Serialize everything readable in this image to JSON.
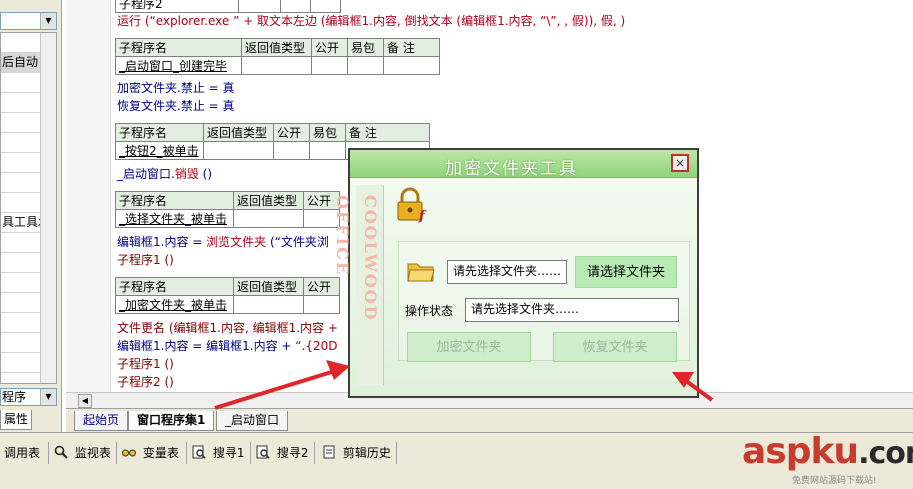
{
  "left_panel": {
    "rows": [
      "",
      "后自动",
      "",
      "",
      "",
      "",
      "",
      "",
      "",
      "具工具木",
      "",
      "",
      "",
      "",
      "",
      "",
      ""
    ],
    "selected_row": 1,
    "combo_value": "程序",
    "tab_label": "属性"
  },
  "editor": {
    "top_table_partial": "子程序2",
    "line_run": [
      "运行 (“",
      "explorer.exe",
      " ” + 取文本左边 (编辑框1.内容, ",
      "倒找文本",
      " (编辑框1.内容, “\\”, , 假)), 假, )"
    ],
    "header": [
      "子程序名",
      "返回值类型",
      "公开",
      "易包",
      "备 注"
    ],
    "sub1_name": "_启动窗口_创建完毕",
    "sub1_lines": [
      "加密文件夹.禁止 = 真",
      "恢复文件夹.禁止 = 真"
    ],
    "sub2_name": "_按钮2_被单击",
    "sub2_line": [
      "_启动窗口.",
      "销毁",
      " ()"
    ],
    "sub3_name": "_选择文件夹_被单击",
    "sub3_line1": [
      "编辑框1.内容 = ",
      "浏览文件夹",
      " (“文件夹浏"
    ],
    "sub3_line2": "子程序1 ()",
    "sub4_name": "_加密文件夹_被单击",
    "sub4_line1": "文件更名 (编辑框1.内容, 编辑框1.内容 +",
    "sub4_line2": [
      "编辑框1.内容 = 编辑框1.内容 + ",
      "“.{20D"
    ],
    "sub4_line3": "子程序1 ()",
    "sub4_line4": "子程序2 ()"
  },
  "editor_tabs": [
    "起始页",
    "窗口程序集1",
    "_启动窗口"
  ],
  "bottom_toolbar": [
    "调用表",
    "监视表",
    "变量表",
    "搜寻1",
    "搜寻2",
    "剪辑历史"
  ],
  "dialog": {
    "title": "加密文件夹工具",
    "close_label": "×",
    "side_text": "COOLWOOD OFFICE",
    "folder_field": "请先选择文件夹……",
    "choose_button": "请选择文件夹",
    "status_label": "操作状态",
    "status_field": "请先选择文件夹……",
    "encrypt_button": "加密文件夹",
    "restore_button": "恢复文件夹"
  },
  "watermark": {
    "logo": "aspku",
    "tld": ".com",
    "subtitle": "免费网站源码下载站!"
  },
  "colors": {
    "keyword_red": "#b0001c",
    "table_header": "#e2eee0",
    "dialog_title_green": "#8fd47a",
    "dialog_button_green": "#b8eab4",
    "arrow_red": "#e0262a"
  }
}
